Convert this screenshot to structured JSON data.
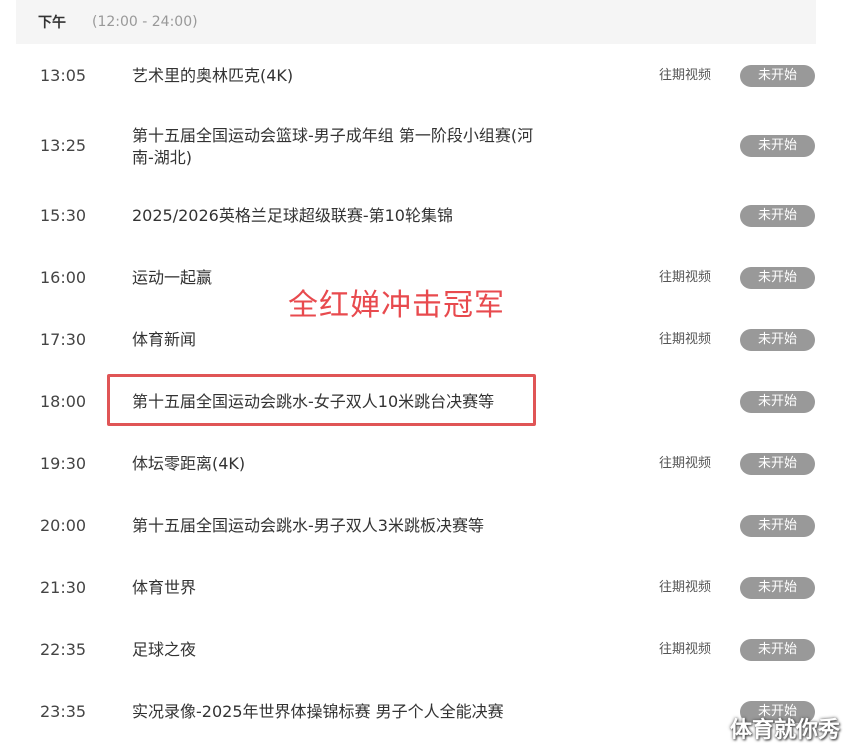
{
  "period": {
    "label": "下午",
    "range": "(12:00 - 24:00)"
  },
  "replay_label": "往期视频",
  "status_label": "未开始",
  "programs": [
    {
      "time": "13:05",
      "title": "艺术里的奥林匹克(4K)",
      "has_replay": true
    },
    {
      "time": "13:25",
      "title": "第十五届全国运动会篮球-男子成年组 第一阶段小组赛(河南-湖北)",
      "has_replay": false
    },
    {
      "time": "15:30",
      "title": "2025/2026英格兰足球超级联赛-第10轮集锦",
      "has_replay": false
    },
    {
      "time": "16:00",
      "title": "运动一起赢",
      "has_replay": true
    },
    {
      "time": "17:30",
      "title": "体育新闻",
      "has_replay": true
    },
    {
      "time": "18:00",
      "title": "第十五届全国运动会跳水-女子双人10米跳台决赛等",
      "has_replay": false
    },
    {
      "time": "19:30",
      "title": "体坛零距离(4K)",
      "has_replay": true
    },
    {
      "time": "20:00",
      "title": "第十五届全国运动会跳水-男子双人3米跳板决赛等",
      "has_replay": false
    },
    {
      "time": "21:30",
      "title": "体育世界",
      "has_replay": true
    },
    {
      "time": "22:35",
      "title": "足球之夜",
      "has_replay": true
    },
    {
      "time": "23:35",
      "title": "实况录像-2025年世界体操锦标赛 男子个人全能决赛",
      "has_replay": false
    }
  ],
  "annotation": "全红婵冲击冠军",
  "watermark": "体育就你秀",
  "colors": {
    "status_bg": "#999999",
    "highlight": "#e05556",
    "annotation": "#e84a4e",
    "header_bg": "#f5f5f5"
  }
}
